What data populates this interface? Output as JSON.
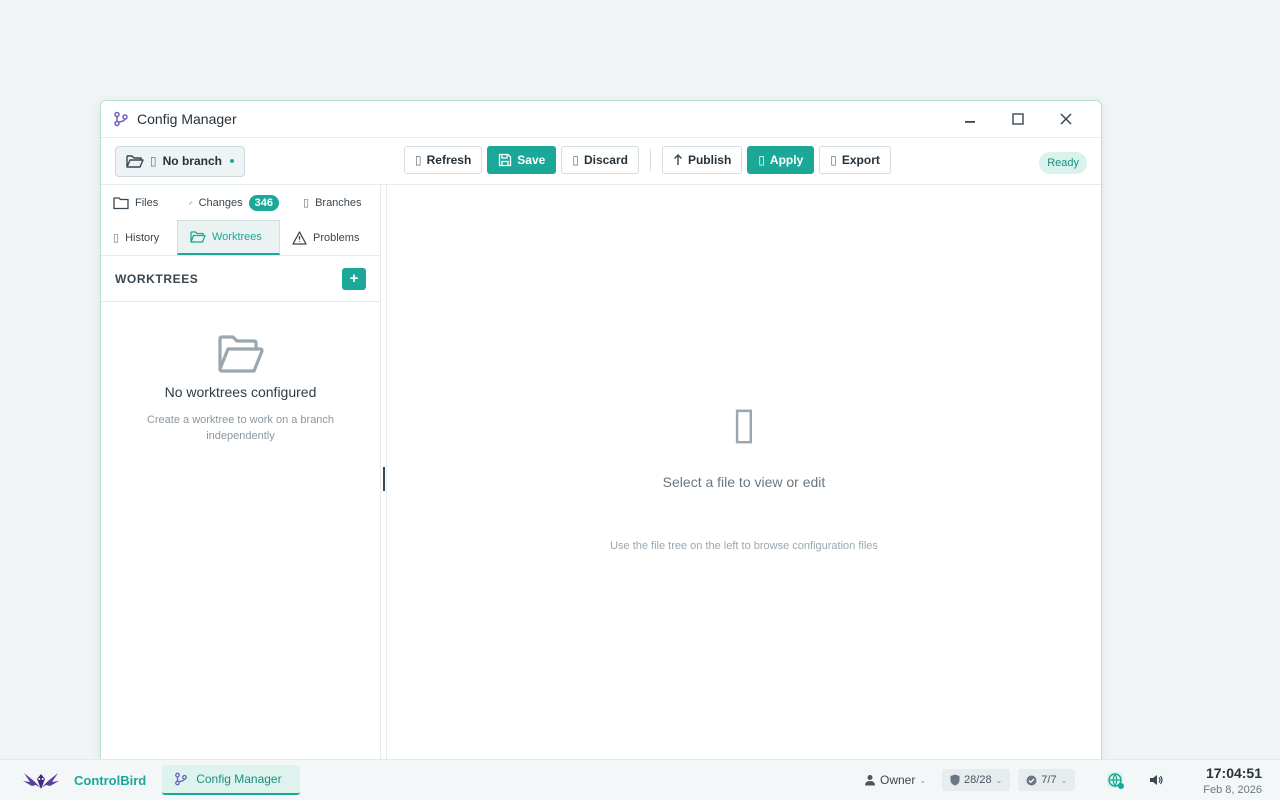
{
  "window": {
    "title": "Config Manager",
    "controls": {
      "minimize": "minimize-icon",
      "maximize": "maximize-icon",
      "close": "close-icon"
    }
  },
  "toolbar": {
    "branch_label": "No branch",
    "refresh_label": "Refresh",
    "save_label": "Save",
    "discard_label": "Discard",
    "publish_label": "Publish",
    "apply_label": "Apply",
    "export_label": "Export",
    "status": "Ready"
  },
  "tabs": [
    {
      "label": "Files",
      "icon": "folder-icon"
    },
    {
      "label": "Changes",
      "icon": "pencil-icon",
      "badge": "346"
    },
    {
      "label": "Branches",
      "icon": "branch-icon"
    },
    {
      "label": "History",
      "icon": "history-icon"
    },
    {
      "label": "Worktrees",
      "icon": "folder-open-icon",
      "active": true
    },
    {
      "label": "Problems",
      "icon": "warning-icon"
    }
  ],
  "worktrees": {
    "header": "WORKTREES",
    "empty_title": "No worktrees configured",
    "empty_sub": "Create a worktree to work on a branch independently"
  },
  "main": {
    "message": "Select a file to view or edit",
    "hint": "Use the file tree on the left to browse configuration files"
  },
  "taskbar": {
    "app_name": "ControlBird",
    "task_label": "Config Manager",
    "user_label": "Owner",
    "shield_count": "28/28",
    "check_count": "7/7",
    "time": "17:04:51",
    "date": "Feb 8, 2026"
  },
  "colors": {
    "accent": "#1ba899",
    "accent_light": "#dff3ee",
    "window_border": "#b5e2d8",
    "logo_purple": "#5a3fa0"
  }
}
